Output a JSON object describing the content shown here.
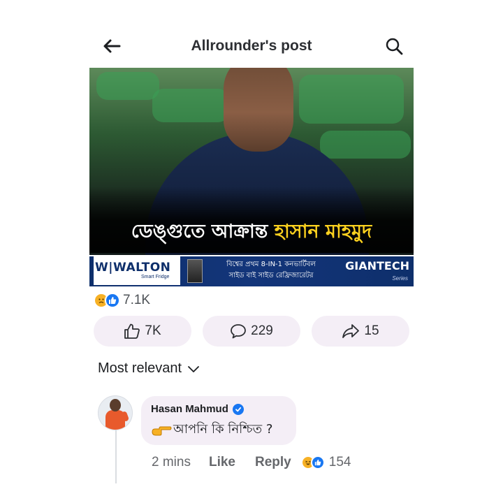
{
  "header": {
    "title": "Allrounder's post",
    "back_icon": "arrow-left-icon",
    "search_icon": "search-icon"
  },
  "post": {
    "headline_white": "ডেঙ্গুতে আক্রান্ত",
    "headline_yellow": "হাসান মাহমুদ",
    "ad": {
      "brand": "W|WALTON",
      "brand_sub": "Smart Fridge",
      "mid_line1": "বিশ্বের প্রথম 8-IN-1 কনভার্টিবল",
      "mid_line2": "সাইড বাই সাইড রেফ্রিজারেটর",
      "right": "GIANTECH",
      "right_sub": "Series"
    }
  },
  "reactions": {
    "icons": [
      "sad-reaction-icon",
      "like-reaction-icon"
    ],
    "count": "7.1K"
  },
  "actions": {
    "like_count": "7K",
    "comment_count": "229",
    "share_count": "15"
  },
  "sort": {
    "label": "Most relevant"
  },
  "comment": {
    "author": "Hasan Mahmud",
    "verified": true,
    "text": "আপনি কি নিশ্চিত ?",
    "time": "2 mins",
    "like_label": "Like",
    "reply_label": "Reply",
    "reaction_icons": [
      "haha-reaction-icon",
      "like-reaction-icon"
    ],
    "reaction_count": "154"
  },
  "colors": {
    "accent": "#1877f2",
    "headline_yellow": "#ffd21f",
    "bubble_bg": "#f4eef6",
    "ad_blue": "#0e2f6b"
  }
}
